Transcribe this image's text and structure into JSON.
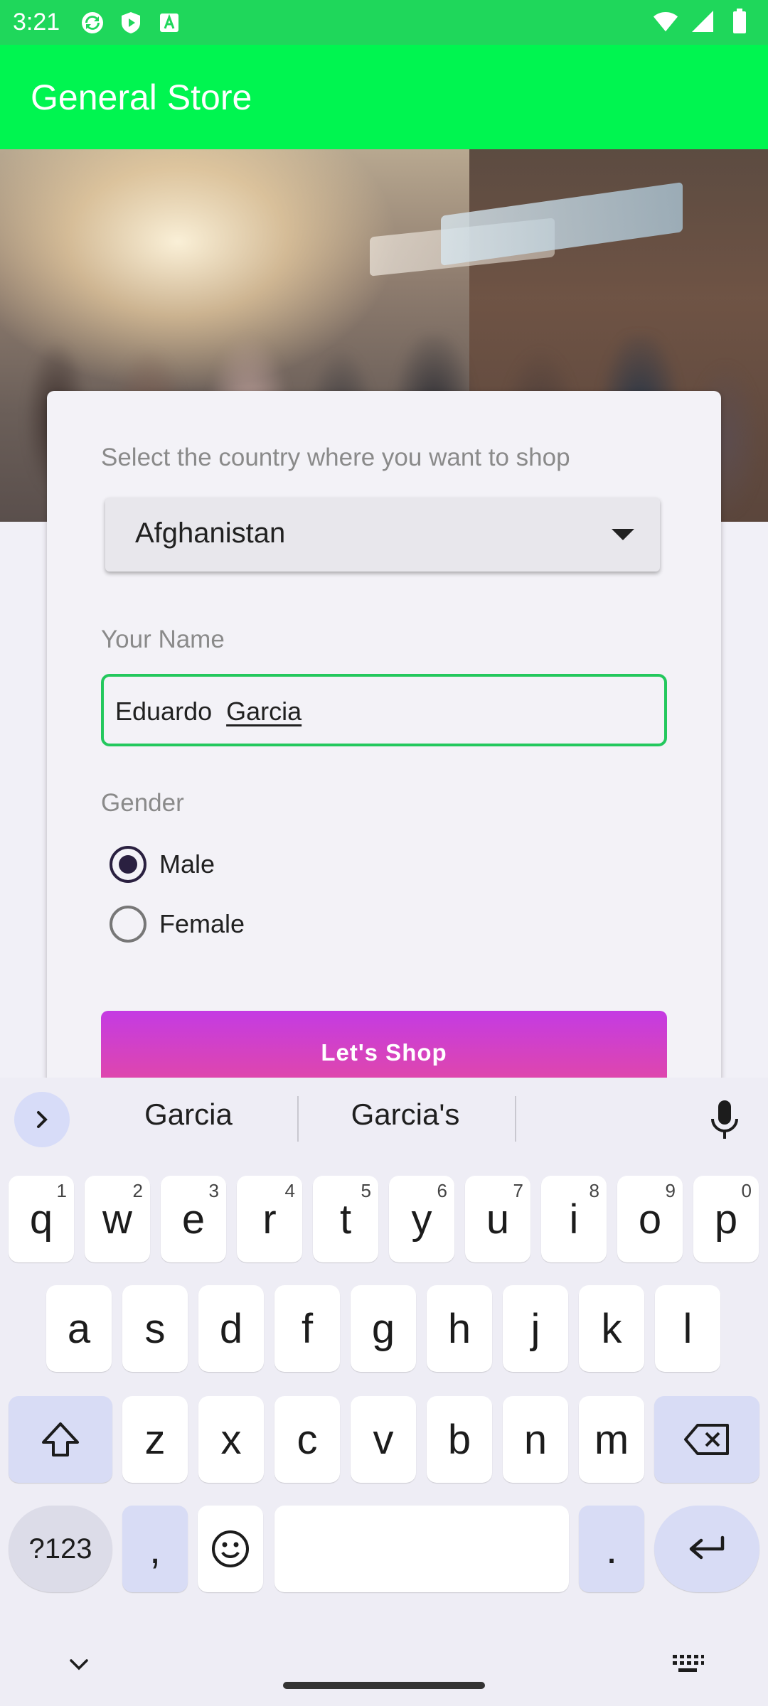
{
  "status_bar": {
    "time": "3:21",
    "icons": [
      "sync-icon",
      "shield-play-icon",
      "text-a-icon",
      "wifi-icon",
      "signal-icon",
      "battery-icon"
    ]
  },
  "app_bar": {
    "title": "General Store"
  },
  "form": {
    "country_label": "Select the country where you want to shop",
    "country_value": "Afghanistan",
    "name_label": "Your Name",
    "name_first": "Eduardo",
    "name_last": "Garcia",
    "gender_label": "Gender",
    "gender_options": [
      {
        "label": "Male",
        "selected": true
      },
      {
        "label": "Female",
        "selected": false
      }
    ],
    "shop_button": "Let's  Shop"
  },
  "keyboard": {
    "suggestions": [
      "Garcia",
      "Garcia's"
    ],
    "row1": [
      {
        "k": "q",
        "h": "1"
      },
      {
        "k": "w",
        "h": "2"
      },
      {
        "k": "e",
        "h": "3"
      },
      {
        "k": "r",
        "h": "4"
      },
      {
        "k": "t",
        "h": "5"
      },
      {
        "k": "y",
        "h": "6"
      },
      {
        "k": "u",
        "h": "7"
      },
      {
        "k": "i",
        "h": "8"
      },
      {
        "k": "o",
        "h": "9"
      },
      {
        "k": "p",
        "h": "0"
      }
    ],
    "row2": [
      "a",
      "s",
      "d",
      "f",
      "g",
      "h",
      "j",
      "k",
      "l"
    ],
    "row3": [
      "z",
      "x",
      "c",
      "v",
      "b",
      "n",
      "m"
    ],
    "sym_key": "?123",
    "comma_key": ",",
    "period_key": "."
  },
  "colors": {
    "status_bar": "#1fd75b",
    "app_bar": "#00f550",
    "field_border": "#23c85d",
    "button_gradient_top": "#c43be3",
    "button_gradient_bottom": "#e84a9a"
  }
}
